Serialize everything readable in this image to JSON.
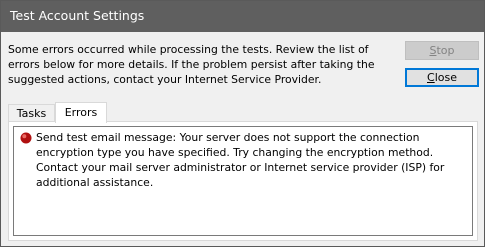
{
  "window": {
    "title": "Test Account Settings"
  },
  "message": "Some errors occurred while processing the tests. Review the list of errors below for more details. If the problem persist after taking the suggested actions, contact your Internet Service Provider.",
  "buttons": {
    "stop": {
      "accel": "S",
      "rest": "top"
    },
    "close": {
      "accel": "C",
      "rest": "lose"
    }
  },
  "tabs": [
    {
      "label": "Tasks",
      "selected": false
    },
    {
      "label": "Errors",
      "selected": true
    }
  ],
  "errors": [
    {
      "icon": "error-icon",
      "text": "Send test email message: Your server does not support the connection encryption type you have specified. Try changing the encryption method. Contact your mail server administrator or Internet service provider (ISP) for additional assistance."
    }
  ],
  "colors": {
    "titlebar": "#5f5f5f",
    "accent_focus": "#0078d7",
    "error_icon": "#b01010"
  }
}
